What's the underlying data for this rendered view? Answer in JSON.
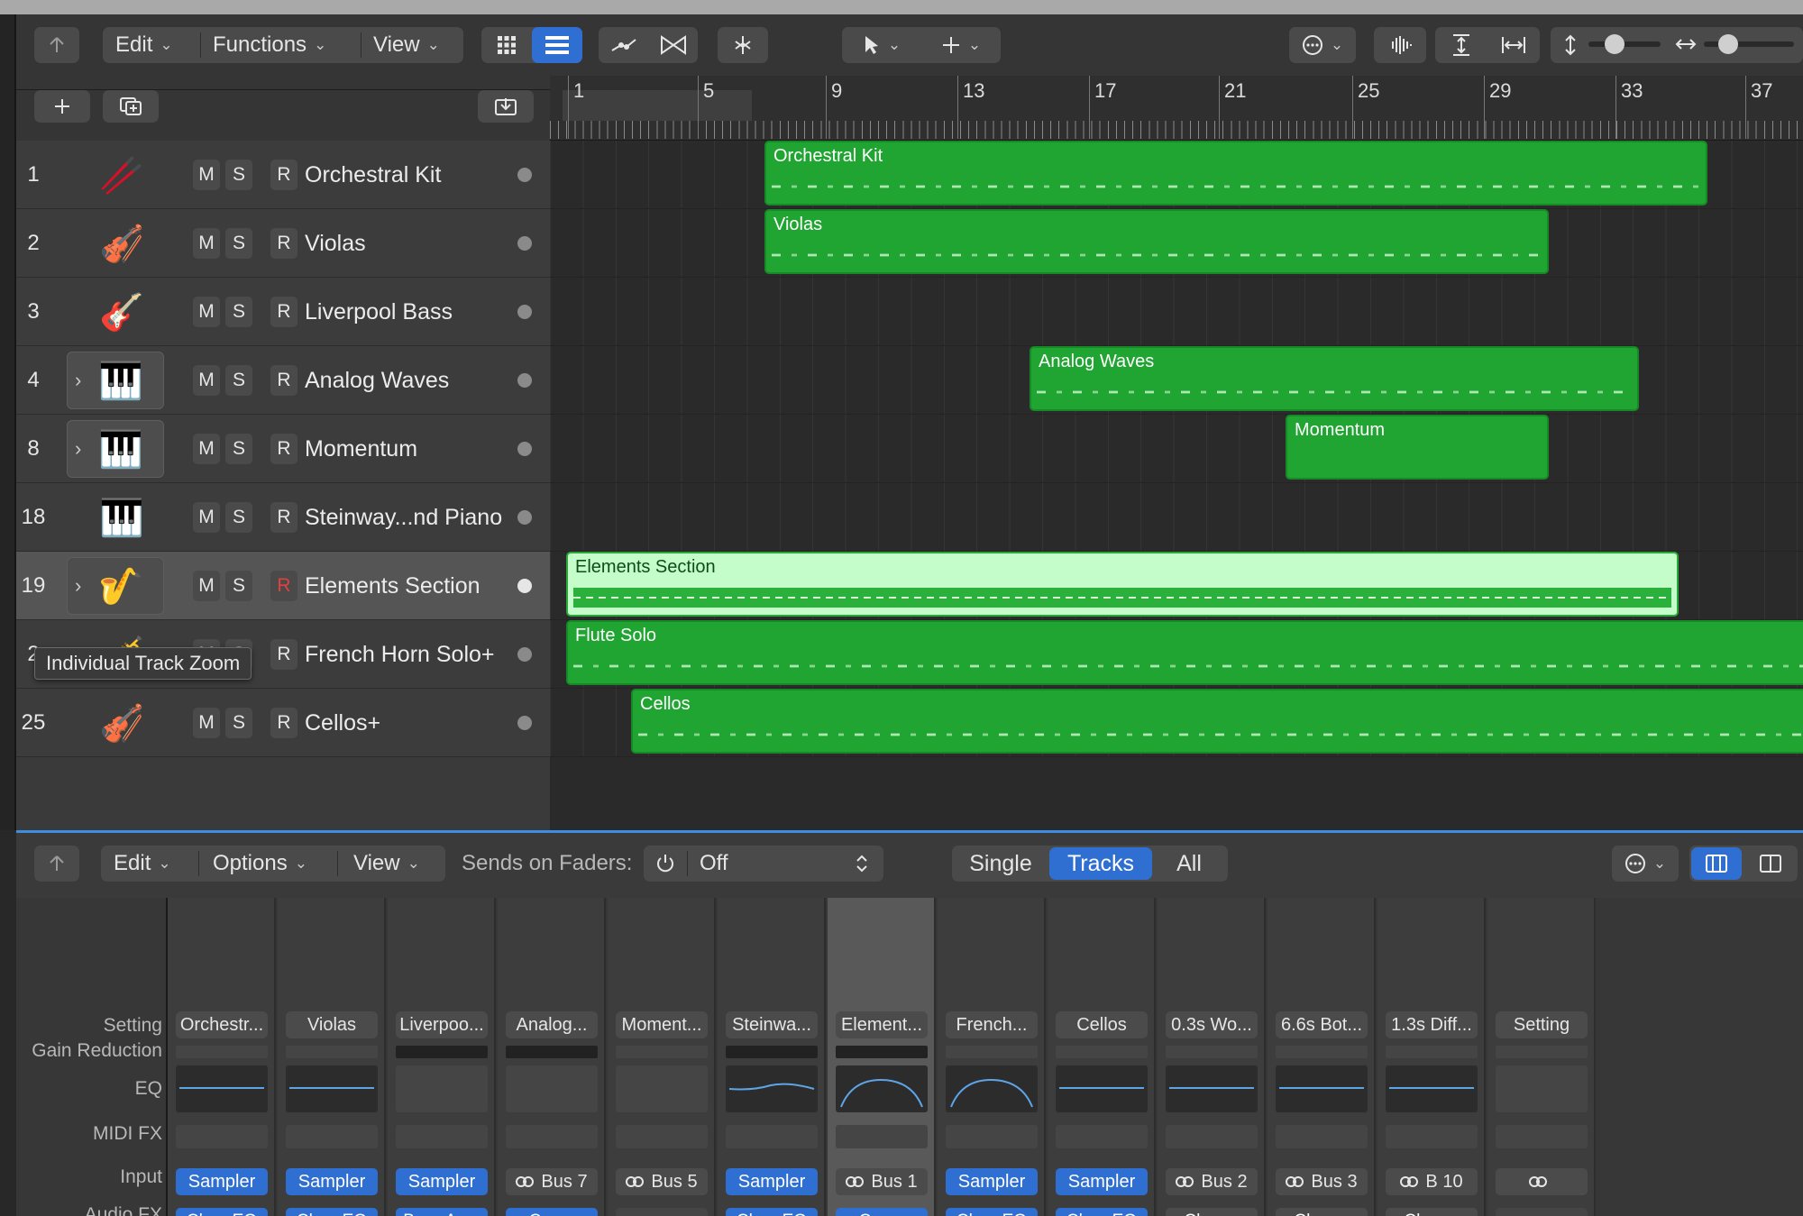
{
  "toolbar": {
    "edit": "Edit",
    "functions": "Functions",
    "view": "View",
    "grid_icon": "grid-view-icon",
    "list_icon": "list-view-icon",
    "automation_icon": "automation-curve-icon",
    "flex_icon": "flex-time-icon",
    "catch_icon": "catch-playhead-icon",
    "pointer_icon": "pointer-tool-icon",
    "pencil_icon": "crosshair-tool-icon",
    "more_icon": "more-options-icon",
    "waveform_icon": "waveform-zoom-icon",
    "vzoom_icon": "vertical-fit-icon",
    "hzoom_icon": "horizontal-fit-icon"
  },
  "header": {
    "add_icon": "add-track-icon",
    "duplicate_icon": "duplicate-track-icon",
    "download_icon": "import-icon"
  },
  "ruler": {
    "bars": [
      "1",
      "5",
      "9",
      "13",
      "17",
      "21",
      "25",
      "29",
      "33",
      "37"
    ]
  },
  "tracks": [
    {
      "num": "1",
      "name": "Orchestral Kit",
      "icon": "🥢",
      "folder": false
    },
    {
      "num": "2",
      "name": "Violas",
      "icon": "🎻",
      "folder": false
    },
    {
      "num": "3",
      "name": "Liverpool Bass",
      "icon": "🎸",
      "folder": false
    },
    {
      "num": "4",
      "name": "Analog Waves",
      "icon": "🎹",
      "folder": true
    },
    {
      "num": "8",
      "name": "Momentum",
      "icon": "🎹",
      "folder": true
    },
    {
      "num": "18",
      "name": "Steinway...nd Piano",
      "icon": "🎹",
      "folder": false
    },
    {
      "num": "19",
      "name": "Elements Section",
      "icon": "🎷",
      "folder": true
    },
    {
      "num": "2",
      "name": "French Horn Solo+",
      "icon": "🎺",
      "folder": false
    },
    {
      "num": "25",
      "name": "Cellos+",
      "icon": "🎻",
      "folder": false
    }
  ],
  "msr": {
    "m": "M",
    "s": "S",
    "r": "R"
  },
  "tooltip": "Individual Track Zoom",
  "regions": {
    "orchestral_kit": "Orchestral Kit",
    "violas": "Violas",
    "analog_waves": "Analog Waves",
    "momentum": "Momentum",
    "elements_section": "Elements Section",
    "flute_solo": "Flute Solo",
    "cellos": "Cellos"
  },
  "mixer": {
    "edit": "Edit",
    "options": "Options",
    "view": "View",
    "sends_label": "Sends on Faders:",
    "sends_value": "Off",
    "single": "Single",
    "tracks": "Tracks",
    "all": "All",
    "row_labels": {
      "setting": "Setting",
      "gain": "Gain Reduction",
      "eq": "EQ",
      "midi": "MIDI FX",
      "input": "Input",
      "audio": "Audio FX"
    },
    "strips": [
      {
        "setting": "Orchestr...",
        "input": "Sampler",
        "fx": "Chan EQ"
      },
      {
        "setting": "Violas",
        "input": "Sampler",
        "fx": "Chan EQ"
      },
      {
        "setting": "Liverpoo...",
        "input": "Sampler",
        "fx": "Bass Amp"
      },
      {
        "setting": "Analog...",
        "input": "Bus 7",
        "fx": "Comp"
      },
      {
        "setting": "Moment...",
        "input": "Bus 5",
        "fx": ""
      },
      {
        "setting": "Steinwa...",
        "input": "Sampler",
        "fx": "Chan EQ"
      },
      {
        "setting": "Element...",
        "input": "Bus 1",
        "fx": "Comp"
      },
      {
        "setting": "French...",
        "input": "Sampler",
        "fx": "Chan EQ"
      },
      {
        "setting": "Cellos",
        "input": "Sampler",
        "fx": "Chan EQ"
      },
      {
        "setting": "0.3s Wo...",
        "input": "Bus 2",
        "fx": "Chorus"
      },
      {
        "setting": "6.6s Bot...",
        "input": "Bus 3",
        "fx": "Chorus"
      },
      {
        "setting": "1.3s Diff...",
        "input": "B 10",
        "fx": "Chorus"
      },
      {
        "setting": "Setting",
        "input": "",
        "fx": ""
      }
    ]
  },
  "colors": {
    "region_green": "#21a532",
    "region_selected": "#c4fdc9",
    "accent_blue": "#2f6fd1"
  }
}
